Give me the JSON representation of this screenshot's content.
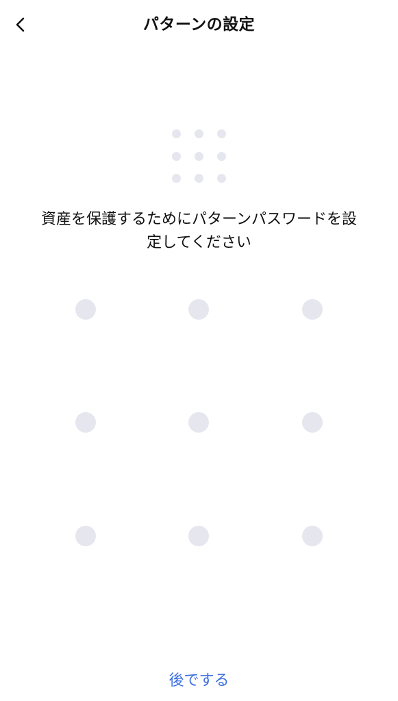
{
  "header": {
    "back_icon": "chevron-left-icon",
    "title": "パターンの設定"
  },
  "preview": {
    "icon": "pattern-grid-icon",
    "dot_color": "#e6e7ee"
  },
  "instruction": {
    "line1": "資産を保護するためにパターンパスワードを設",
    "line2": "定してください"
  },
  "pattern_pad": {
    "rows": 3,
    "cols": 3,
    "dot_color": "#e6e7ee"
  },
  "footer": {
    "later_label": "後でする",
    "accent_color": "#3d6fe0"
  }
}
